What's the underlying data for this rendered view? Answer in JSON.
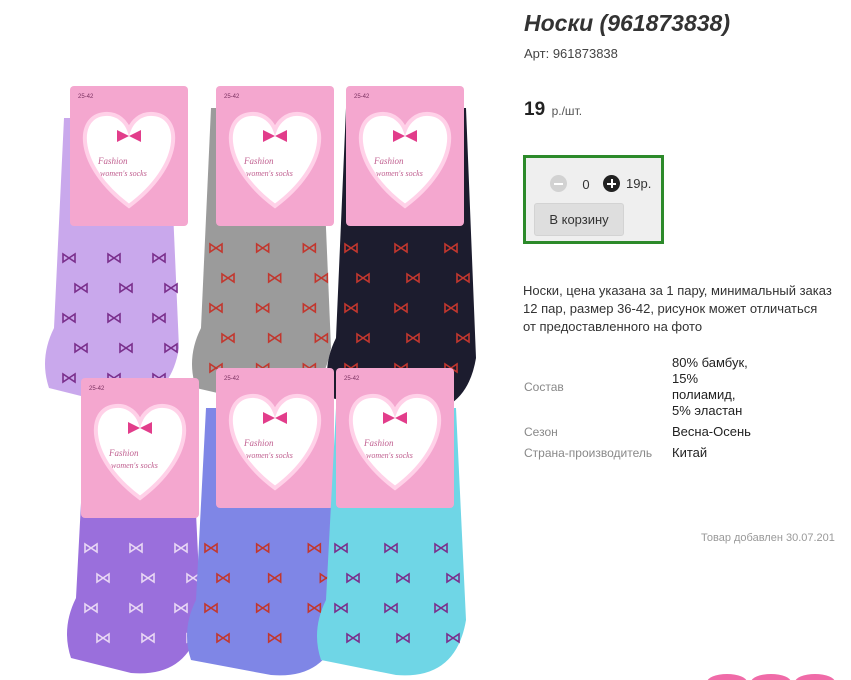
{
  "product": {
    "title": "Носки (961873838)",
    "sku_label": "Арт:",
    "sku_value": "961873838",
    "price_value": "19",
    "price_unit": "р./шт.",
    "description": "Носки, цена указана за 1 пару, минимальный заказ 12 пар, размер 36-42, рисунок может отличаться от предоставленного на фото"
  },
  "cart": {
    "quantity": "0",
    "total": "19р.",
    "add_button_label": "В корзину",
    "minus_icon": "minus-circle-icon",
    "plus_icon": "plus-circle-icon",
    "border_color": "#2c8a2a"
  },
  "properties": [
    {
      "label": "Состав",
      "value": "80% бамбук, 15% полиамид, 5% эластан"
    },
    {
      "label": "Сезон",
      "value": "Весна-Осень"
    },
    {
      "label": "Страна-производитель",
      "value": "Китай"
    }
  ],
  "meta": {
    "added_label": "Товар добавлен",
    "added_date": "30.07.201"
  },
  "photo": {
    "card_text_line1": "Fashion",
    "card_text_line2": "women's socks",
    "size_tag": "25-42",
    "sock_colors": [
      "#c9a8ec",
      "#9b9b9b",
      "#1c1c2e",
      "#9a6fdc",
      "#7f86e6",
      "#6fd6e6"
    ],
    "bow_colors": [
      "#7a2f8c",
      "#c2372e",
      "#c2372e",
      "#e8d6f4",
      "#c2372e",
      "#7a2f8c"
    ],
    "card_color": "#f4a7cf"
  }
}
